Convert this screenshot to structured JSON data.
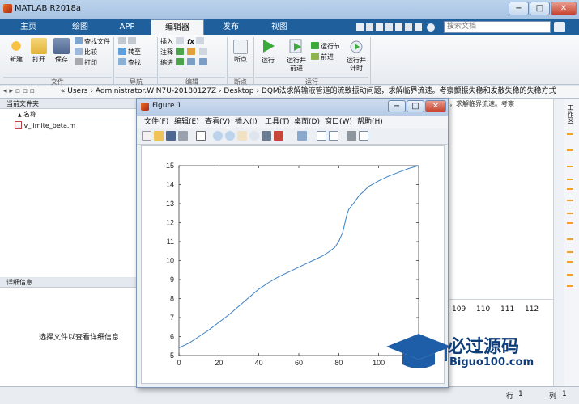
{
  "window": {
    "title": "MATLAB R2018a",
    "min": "−",
    "max": "□",
    "close": "✕"
  },
  "tabs": [
    "主页",
    "绘图",
    "APP",
    "编辑器",
    "发布",
    "视图"
  ],
  "active_tab": 3,
  "search_placeholder": "搜索文档",
  "ribbon": {
    "file": {
      "new": "新建",
      "open": "打开",
      "save": "保存",
      "find_files": "查找文件",
      "compare": "比较",
      "print": "打印",
      "group": "文件"
    },
    "nav": {
      "goto": "转至",
      "find": "查找",
      "group": "导航"
    },
    "edit": {
      "insert": "插入",
      "comment": "注释",
      "indent": "缩进",
      "fx": "fx",
      "group": "编辑"
    },
    "breakpoints": {
      "label": "断点",
      "group": "断点"
    },
    "run": {
      "run": "运行",
      "run_advance_1": "运行并",
      "run_advance_2": "前进",
      "run_section": "运行节",
      "advance": "前进",
      "run_time_1": "运行并",
      "run_time_2": "计时",
      "group": "运行"
    }
  },
  "address": {
    "parts": [
      "«",
      "Users",
      "›",
      "Administrator.WIN7U-20180127Z",
      "›",
      "Desktop",
      "›",
      "DQM法求解输液管道的流致振动问题，求解临界流速。考察颤振失稳和发散失稳的失稳方式"
    ]
  },
  "left_pane": {
    "header": "当前文件夹",
    "column": "名称",
    "sort": "▲",
    "files": [
      "v_limite_beta.m"
    ]
  },
  "detail": {
    "header": "详细信息",
    "hint": "选择文件以查看详细信息"
  },
  "right_header": "，求解临界流速。考察",
  "right_numbers": [
    "109",
    "110",
    "111",
    "112"
  ],
  "right_side_label": "工作区",
  "status": {
    "row_label": "行",
    "row": "1",
    "col_label": "列",
    "col": "1"
  },
  "figure": {
    "title": "Figure 1",
    "menu": [
      "文件(F)",
      "编辑(E)",
      "查看(V)",
      "插入(I)",
      "工具(T)",
      "桌面(D)",
      "窗口(W)",
      "帮助(H)"
    ],
    "min": "−",
    "max": "□",
    "close": "✕"
  },
  "watermark": {
    "text_cn": "必过源码",
    "text_en": "Biguo100.com"
  },
  "colors": {
    "line": "#3a80c4",
    "tab_bar": "#1f5f9c"
  },
  "chart_data": {
    "type": "line",
    "title": "",
    "xlabel": "",
    "ylabel": "",
    "xlim": [
      0,
      120
    ],
    "ylim": [
      5,
      15
    ],
    "xticks": [
      0,
      20,
      40,
      60,
      80,
      100,
      120
    ],
    "yticks": [
      5,
      6,
      7,
      8,
      9,
      10,
      11,
      12,
      13,
      14,
      15
    ],
    "grid": false,
    "series": [
      {
        "x": [
          0,
          5,
          10,
          15,
          20,
          25,
          30,
          35,
          40,
          45,
          50,
          55,
          60,
          65,
          70,
          72,
          75,
          78,
          80,
          82,
          84,
          85,
          88,
          90,
          95,
          100,
          105,
          110,
          115,
          120
        ],
        "y": [
          5.4,
          5.65,
          6.0,
          6.35,
          6.75,
          7.15,
          7.6,
          8.05,
          8.5,
          8.85,
          9.15,
          9.4,
          9.65,
          9.9,
          10.15,
          10.25,
          10.45,
          10.7,
          11.0,
          11.5,
          12.4,
          12.7,
          13.1,
          13.4,
          13.9,
          14.2,
          14.45,
          14.65,
          14.85,
          15.0
        ]
      }
    ]
  }
}
